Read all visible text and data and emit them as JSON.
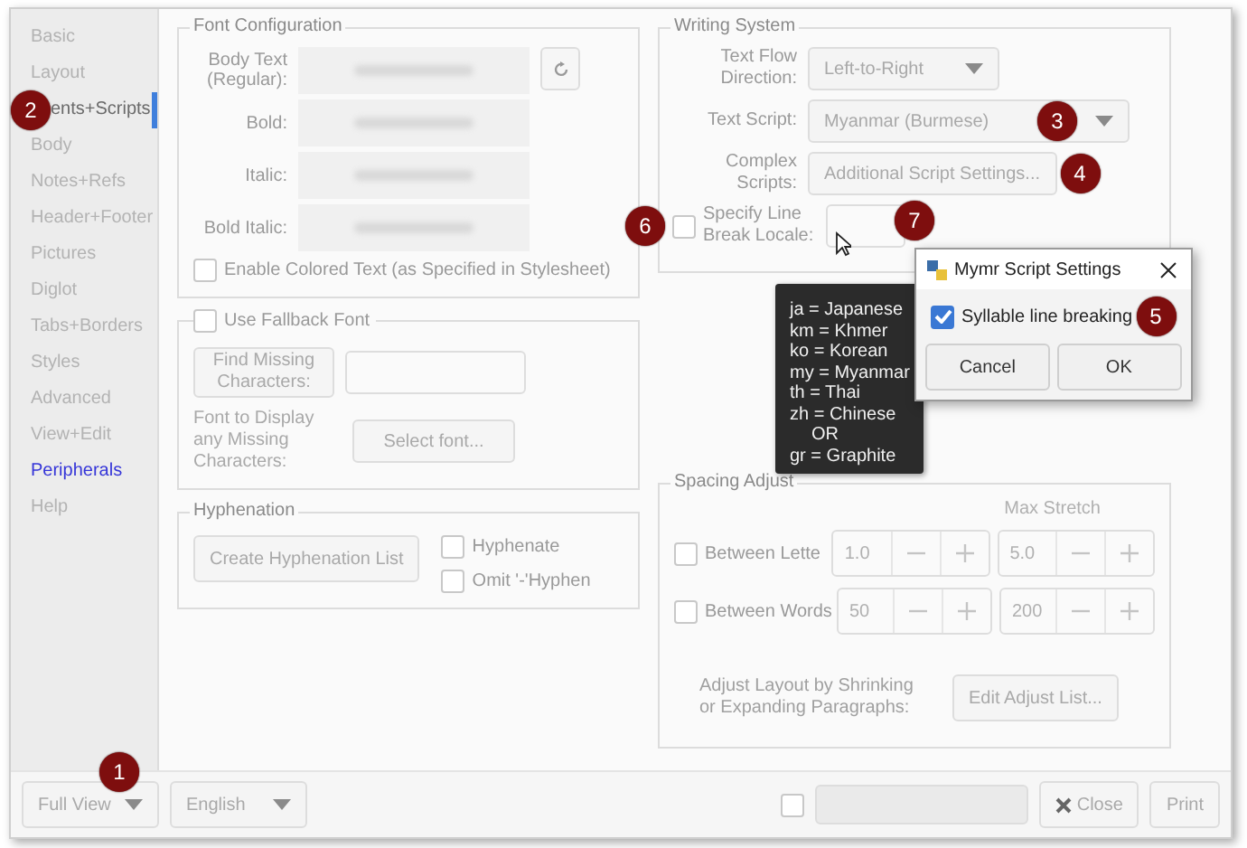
{
  "sidebar": {
    "items": [
      {
        "label": "Basic",
        "selected": false,
        "hovered": false
      },
      {
        "label": "Layout",
        "selected": false,
        "hovered": false
      },
      {
        "label": "ents+Scripts",
        "selected": true,
        "hovered": false,
        "badge": "2"
      },
      {
        "label": "Body",
        "selected": false,
        "hovered": false
      },
      {
        "label": "Notes+Refs",
        "selected": false,
        "hovered": false
      },
      {
        "label": "Header+Footer",
        "selected": false,
        "hovered": false
      },
      {
        "label": "Pictures",
        "selected": false,
        "hovered": false
      },
      {
        "label": "Diglot",
        "selected": false,
        "hovered": false
      },
      {
        "label": "Tabs+Borders",
        "selected": false,
        "hovered": false
      },
      {
        "label": "Styles",
        "selected": false,
        "hovered": false
      },
      {
        "label": "Advanced",
        "selected": false,
        "hovered": false
      },
      {
        "label": "View+Edit",
        "selected": false,
        "hovered": false
      },
      {
        "label": "Peripherals",
        "selected": false,
        "hovered": true
      },
      {
        "label": "Help",
        "selected": false,
        "hovered": false
      }
    ]
  },
  "font_configuration": {
    "title": "Font Configuration",
    "fields": [
      {
        "label": "Body Text (Regular):"
      },
      {
        "label": "Bold:"
      },
      {
        "label": "Italic:"
      },
      {
        "label": "Bold Italic:"
      }
    ],
    "colored_text": {
      "label": "Enable Colored Text (as Specified in Stylesheet)",
      "checked": false
    }
  },
  "fallback_font": {
    "label": "Use Fallback Font",
    "checked": false,
    "find_button": "Find Missing Characters:",
    "display_label": "Font to Display any Missing Characters:",
    "select_button": "Select font..."
  },
  "hyphenation": {
    "title": "Hyphenation",
    "create_button": "Create Hyphenation List",
    "options": [
      {
        "label": "Hyphenate",
        "checked": false
      },
      {
        "label": "Omit '-'Hyphen",
        "checked": false
      }
    ]
  },
  "writing_system": {
    "title": "Writing System",
    "text_flow": {
      "label": "Text Flow Direction:",
      "value": "Left-to-Right"
    },
    "text_script": {
      "label": "Text Script:",
      "value": "Myanmar (Burmese)",
      "badge": "3"
    },
    "complex_scripts": {
      "label": "Complex Scripts:",
      "button": "Additional Script Settings...",
      "badge": "4"
    },
    "line_break": {
      "label": "Specify Line Break Locale:",
      "checked": false,
      "badge": "6",
      "field_badge": "7"
    }
  },
  "spacing": {
    "title": "Spacing Adjust",
    "column": "Max Stretch",
    "rows": [
      {
        "label": "Between Lette",
        "checked": false,
        "min": "1.0",
        "max": "5.0"
      },
      {
        "label": "Between Words",
        "checked": false,
        "min": "50",
        "max": "200"
      }
    ],
    "adjust_label": "Adjust Layout by Shrinking or Expanding Paragraphs:",
    "adjust_button": "Edit Adjust List..."
  },
  "bottom_bar": {
    "view": "Full View",
    "view_badge": "1",
    "language": "English",
    "checked": false,
    "close": "Close",
    "print": "Print"
  },
  "tooltip": {
    "lines": [
      {
        "text": "ja = Japanese",
        "kind": "entry"
      },
      {
        "text": "km = Khmer",
        "kind": "entry"
      },
      {
        "text": "ko = Korean",
        "kind": "entry"
      },
      {
        "text": "my = Myanmar",
        "kind": "entry"
      },
      {
        "text": "th = Thai",
        "kind": "entry"
      },
      {
        "text": "zh = Chinese",
        "kind": "entry"
      },
      {
        "text": "OR",
        "kind": "separator"
      },
      {
        "text": "gr = Graphite",
        "kind": "entry"
      }
    ]
  },
  "dialog": {
    "title": "Mymr Script Settings",
    "checkbox": {
      "label": "Syllable line breaking",
      "checked": true,
      "badge": "5"
    },
    "buttons": [
      "Cancel",
      "OK"
    ]
  }
}
